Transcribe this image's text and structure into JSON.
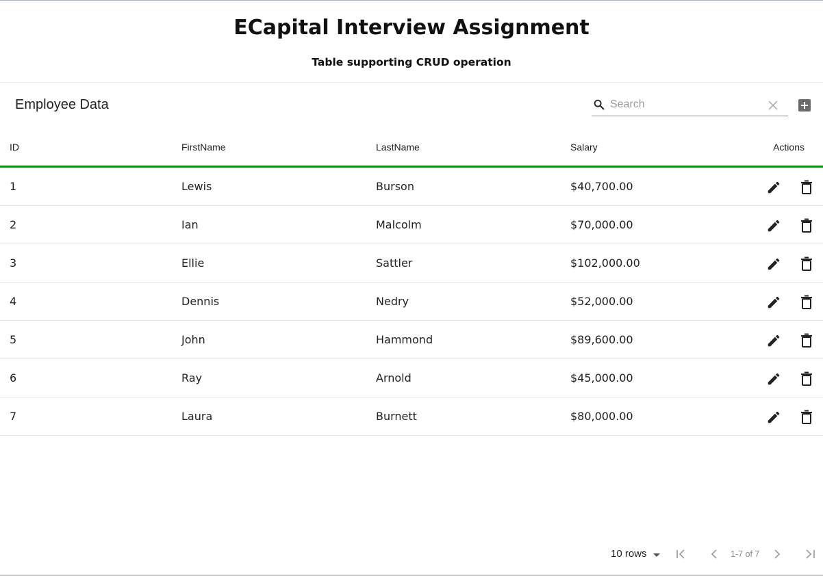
{
  "header": {
    "title": "ECapital Interview Assignment",
    "subtitle": "Table supporting CRUD operation"
  },
  "toolbar": {
    "table_title": "Employee Data",
    "search_placeholder": "Search",
    "search_value": ""
  },
  "table": {
    "columns": [
      "ID",
      "FirstName",
      "LastName",
      "Salary",
      "Actions"
    ],
    "rows": [
      {
        "id": "1",
        "first": "Lewis",
        "last": "Burson",
        "salary": "$40,700.00"
      },
      {
        "id": "2",
        "first": "Ian",
        "last": "Malcolm",
        "salary": "$70,000.00"
      },
      {
        "id": "3",
        "first": "Ellie",
        "last": "Sattler",
        "salary": "$102,000.00"
      },
      {
        "id": "4",
        "first": "Dennis",
        "last": "Nedry",
        "salary": "$52,000.00"
      },
      {
        "id": "5",
        "first": "John",
        "last": "Hammond",
        "salary": "$89,600.00"
      },
      {
        "id": "6",
        "first": "Ray",
        "last": "Arnold",
        "salary": "$45,000.00"
      },
      {
        "id": "7",
        "first": "Laura",
        "last": "Burnett",
        "salary": "$80,000.00"
      }
    ]
  },
  "pagination": {
    "rows_per_page": "10 rows",
    "range_label": "1-7 of 7"
  },
  "colors": {
    "header_accent": "#138a13",
    "icon": "#222222",
    "disabled_icon": "#a0a0a0"
  },
  "icons": {
    "search": "search-icon",
    "clear": "close-icon",
    "add": "add-box-icon",
    "edit": "pencil-icon",
    "delete": "trash-icon",
    "first_page": "first-page-icon",
    "prev_page": "chevron-left-icon",
    "next_page": "chevron-right-icon",
    "last_page": "last-page-icon"
  }
}
